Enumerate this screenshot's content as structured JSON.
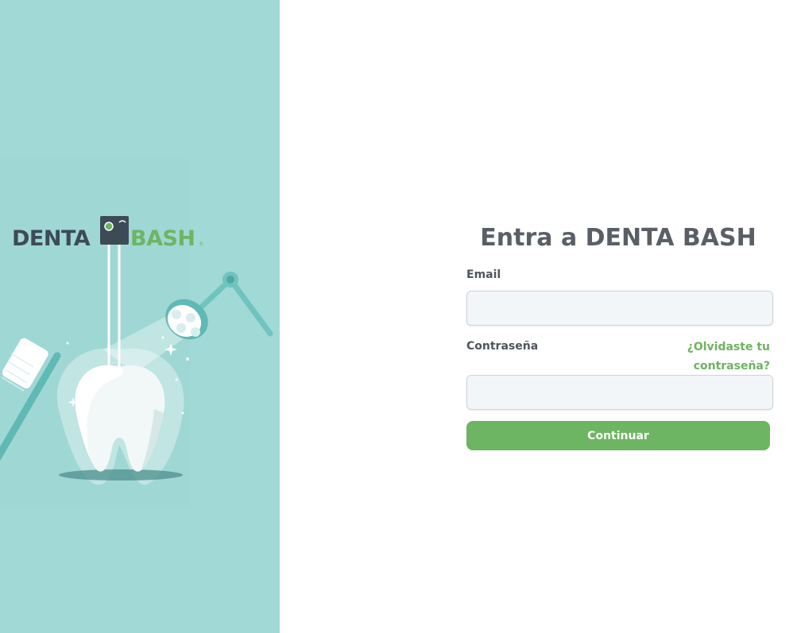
{
  "brand": {
    "logo_left": "DENTA",
    "logo_right": "BASH",
    "logo_mark": "®",
    "colors": {
      "panel_bg": "#a1d9d7",
      "logo_dark": "#3d4b57",
      "logo_green": "#6db562",
      "accent_teal": "#6fc4bf"
    }
  },
  "login": {
    "title": "Entra a DENTA BASH",
    "email_label": "Email",
    "email_value": "",
    "password_label": "Contraseña",
    "password_value": "",
    "forgot_link_line1": "¿Olvidaste tu",
    "forgot_link_line2": "contraseña?",
    "continue_label": "Continuar"
  },
  "theme": {
    "title_color": "#5a5f66",
    "link_color": "#6db360",
    "button_color": "#6db562",
    "input_bg": "#f3f6f9"
  }
}
